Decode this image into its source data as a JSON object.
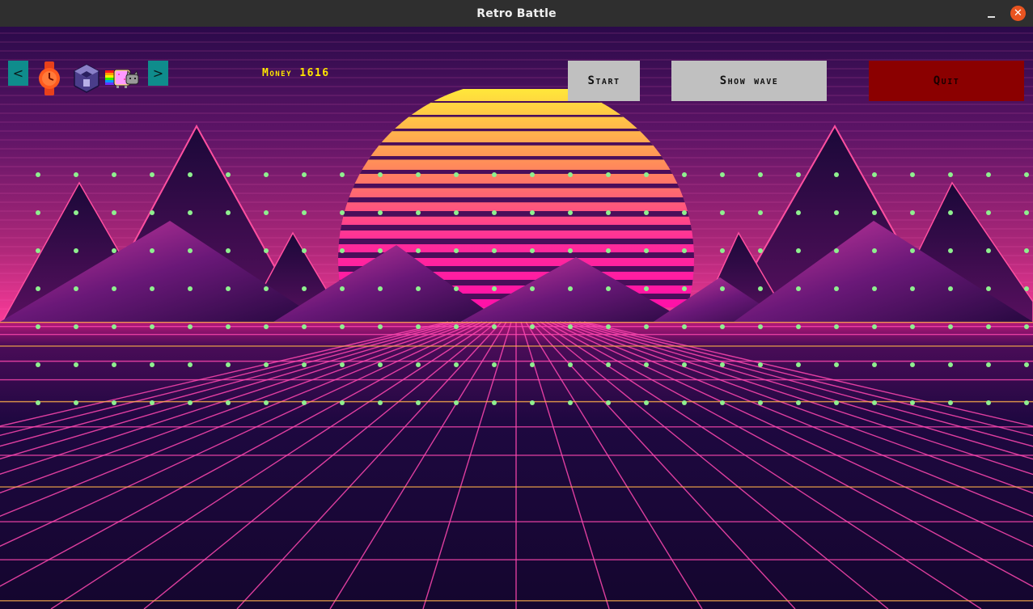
{
  "window": {
    "title": "Retro Battle"
  },
  "hud": {
    "prev_label": "<",
    "next_label": ">",
    "money_text": "Money 1616",
    "start_label": "Start",
    "show_wave_label": "Show wave",
    "quit_label": "Quit"
  },
  "tower_bar": {
    "items": [
      {
        "icon": "watch-icon"
      },
      {
        "icon": "gamecube-icon"
      },
      {
        "icon": "nyan-cat-icon"
      }
    ]
  },
  "colors": {
    "placement_dot": "#8ff08f",
    "quit_button": "#8b0000",
    "nav_arrow": "#0f8c8c",
    "money_text": "#ffe600"
  }
}
